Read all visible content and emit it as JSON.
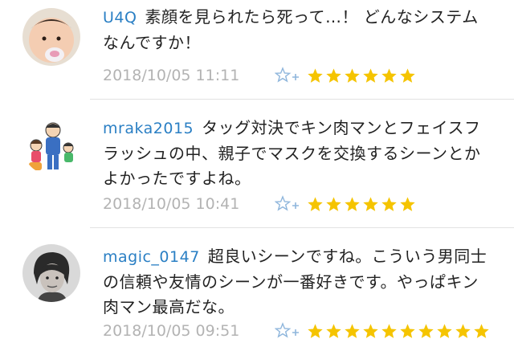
{
  "comments": [
    {
      "username": "U4Q",
      "text": "素顔を見られたら死って…！ どんなシステムなんですか！",
      "timestamp": "2018/10/05 11:11",
      "stars": 6,
      "avatar_icon": "baby-avatar-icon"
    },
    {
      "username": "mraka2015",
      "text": "タッグ対決でキン肉マンとフェイスフラッシュの中、親子でマスクを交換するシーンとかよかったですよね。",
      "timestamp": "2018/10/05 10:41",
      "stars": 6,
      "avatar_icon": "family-avatar-icon"
    },
    {
      "username": "magic_0147",
      "text": "超良いシーンですね。こういう男同士の信頼や友情のシーンが一番好きです。やっぱキン肉マン最高だな。",
      "timestamp": "2018/10/05 09:51",
      "stars": 10,
      "avatar_icon": "portrait-avatar-icon"
    }
  ],
  "colors": {
    "username": "#2a7fc4",
    "timestamp": "#b3b3b3",
    "star": "#f5c400",
    "add_star": "#8fb6dc"
  }
}
